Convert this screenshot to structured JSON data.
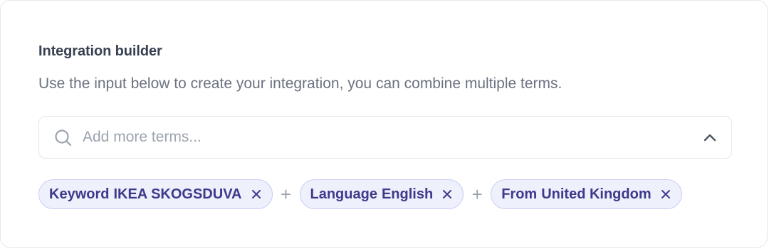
{
  "builder": {
    "title": "Integration builder",
    "description": "Use the input below to create your integration, you can combine multiple terms."
  },
  "search": {
    "placeholder": "Add more terms...",
    "value": "",
    "icon": "search-icon",
    "toggle_icon": "chevron-up-icon"
  },
  "terms": [
    {
      "key": "Keyword",
      "value": "IKEA SKOGSDUVA",
      "remove_icon": "close-icon"
    },
    {
      "key": "Language",
      "value": "English",
      "remove_icon": "close-icon"
    },
    {
      "key": "From",
      "value": "United Kingdom",
      "remove_icon": "close-icon"
    }
  ],
  "separator": "+",
  "colors": {
    "chip_background": "#eef0fc",
    "chip_border": "#c9cdf3",
    "chip_text": "#3d3a8c",
    "muted_text": "#6b7280",
    "title_text": "#374151"
  }
}
